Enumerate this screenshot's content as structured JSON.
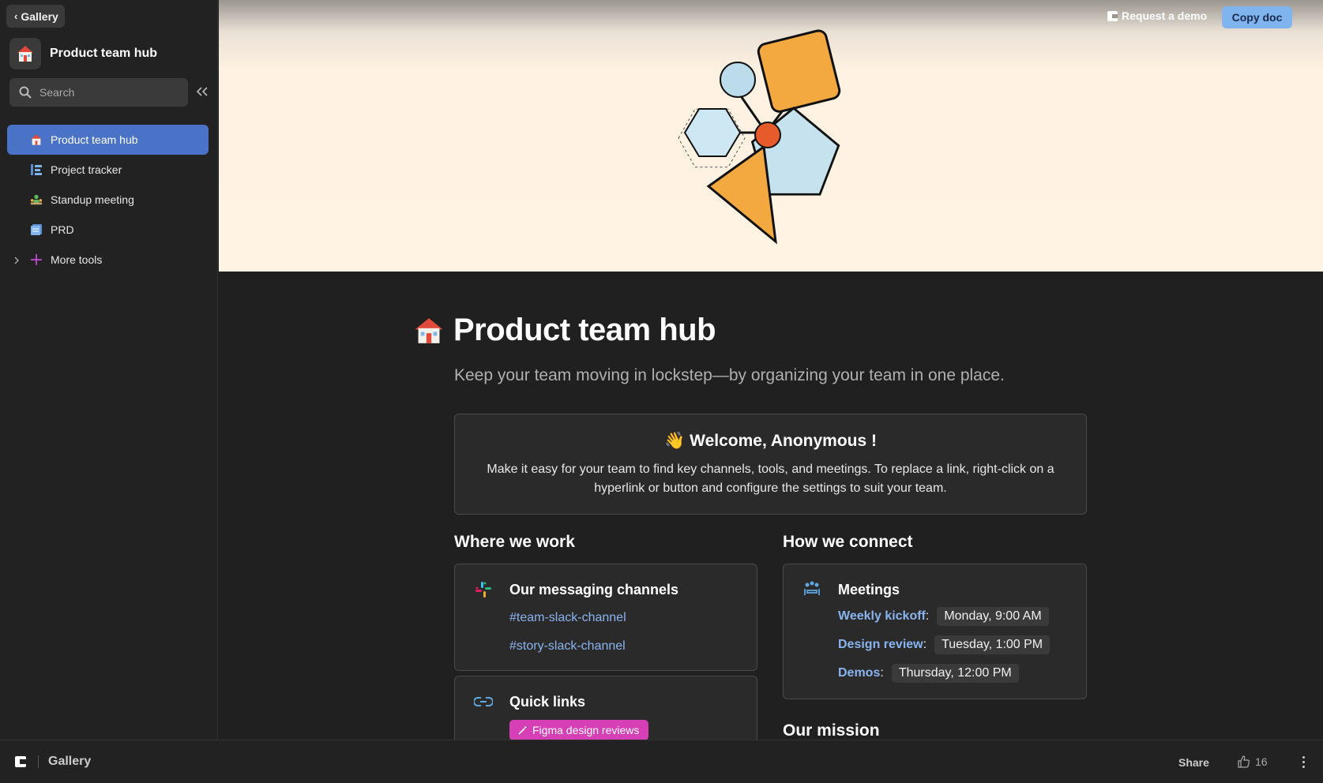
{
  "sidebar": {
    "gallery_label": "Gallery",
    "hub_title": "Product team hub",
    "search_placeholder": "Search",
    "items": [
      {
        "label": "Product team hub",
        "icon": "house-icon",
        "active": true
      },
      {
        "label": "Project tracker",
        "icon": "tracker-icon"
      },
      {
        "label": "Standup meeting",
        "icon": "people-icon"
      },
      {
        "label": "PRD",
        "icon": "document-icon"
      },
      {
        "label": "More tools",
        "icon": "plus-icon"
      }
    ]
  },
  "topbar": {
    "request_demo": "Request a demo",
    "copy_doc": "Copy doc"
  },
  "page": {
    "title": "Product team hub",
    "subtitle": "Keep your team moving in lockstep—by organizing your team in one place.",
    "welcome": {
      "heading": "Welcome, Anonymous !",
      "body": "Make it easy for your team to find key channels, tools, and meetings. To replace a link, right-click on a hyperlink or button and configure the settings to suit your team."
    },
    "where_we_work": {
      "heading": "Where we work",
      "channels_title": "Our messaging channels",
      "channels": [
        "#team-slack-channel",
        "#story-slack-channel"
      ],
      "quick_links_title": "Quick links",
      "quick_link_tag": "Figma design reviews"
    },
    "how_we_connect": {
      "heading": "How we connect",
      "meetings_title": "Meetings",
      "meetings": [
        {
          "name": "Weekly kickoff",
          "time": "Monday, 9:00 AM"
        },
        {
          "name": "Design review",
          "time": "Tuesday, 1:00 PM"
        },
        {
          "name": "Demos",
          "time": "Thursday, 12:00 PM"
        }
      ]
    },
    "mission_heading": "Our mission"
  },
  "bottombar": {
    "gallery": "Gallery",
    "share": "Share",
    "likes": "16"
  },
  "colors": {
    "accent": "#4a72c6",
    "link": "#8ab4f0",
    "copy_button": "#7fb4ef",
    "figma_tag": "#d63fb5",
    "banner": "#fff3e3"
  }
}
